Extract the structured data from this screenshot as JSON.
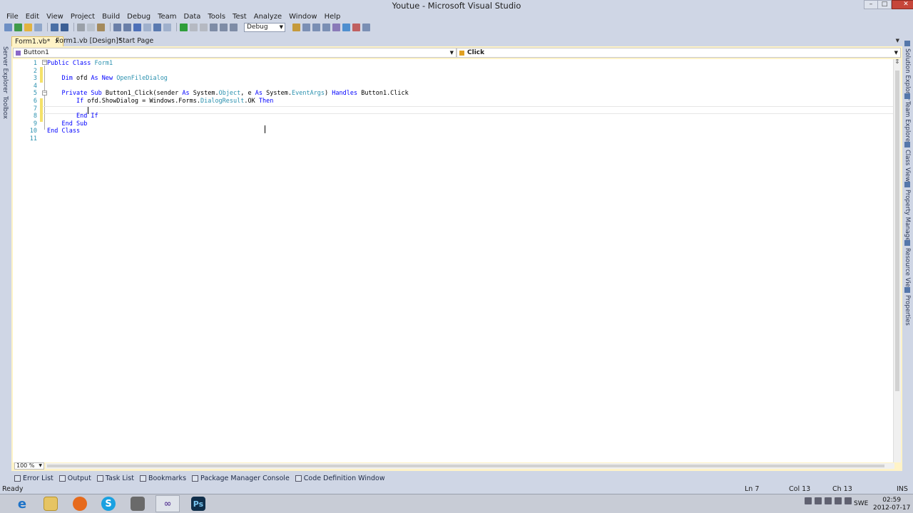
{
  "window": {
    "title": "Youtue - Microsoft Visual Studio",
    "min_glyph": "–",
    "max_glyph": "□",
    "close_glyph": "✕"
  },
  "menu": [
    "File",
    "Edit",
    "View",
    "Project",
    "Build",
    "Debug",
    "Team",
    "Data",
    "Tools",
    "Test",
    "Analyze",
    "Window",
    "Help"
  ],
  "toolbar": {
    "configuration": "Debug"
  },
  "doc_tabs": [
    {
      "label": "Form1.vb*",
      "active": true
    },
    {
      "label": "Form1.vb [Design]*",
      "active": false
    },
    {
      "label": "Start Page",
      "active": false
    }
  ],
  "nav": {
    "class_combo": "Button1",
    "member_combo": "Click"
  },
  "left_panels": [
    "Server Explorer",
    "Toolbox"
  ],
  "right_panels": [
    "Solution Explorer",
    "Team Explorer",
    "Class View",
    "Property Manager",
    "Resource View",
    "Properties"
  ],
  "editor": {
    "line_numbers": [
      "1",
      "2",
      "3",
      "4",
      "5",
      "6",
      "7",
      "8",
      "9",
      "10",
      "11"
    ],
    "lines": [
      [
        {
          "t": "Public Class ",
          "c": "kw"
        },
        {
          "t": "Form1",
          "c": "ty"
        }
      ],
      [],
      [
        {
          "t": "    "
        },
        {
          "t": "Dim",
          "c": "kw"
        },
        {
          "t": " ofd "
        },
        {
          "t": "As New",
          "c": "kw"
        },
        {
          "t": " "
        },
        {
          "t": "OpenFileDialog",
          "c": "ty"
        }
      ],
      [],
      [
        {
          "t": "    "
        },
        {
          "t": "Private Sub",
          "c": "kw"
        },
        {
          "t": " Button1_Click(sender "
        },
        {
          "t": "As",
          "c": "kw"
        },
        {
          "t": " System."
        },
        {
          "t": "Object",
          "c": "ty"
        },
        {
          "t": ", e "
        },
        {
          "t": "As",
          "c": "kw"
        },
        {
          "t": " System."
        },
        {
          "t": "EventArgs",
          "c": "ty"
        },
        {
          "t": ") "
        },
        {
          "t": "Handles",
          "c": "kw"
        },
        {
          "t": " Button1.Click"
        }
      ],
      [
        {
          "t": "        "
        },
        {
          "t": "If",
          "c": "kw"
        },
        {
          "t": " ofd.ShowDialog = Windows.Forms."
        },
        {
          "t": "DialogResult",
          "c": "ty"
        },
        {
          "t": ".OK "
        },
        {
          "t": "Then",
          "c": "kw"
        }
      ],
      [],
      [
        {
          "t": "        "
        },
        {
          "t": "End If",
          "c": "kw"
        }
      ],
      [
        {
          "t": "    "
        },
        {
          "t": "End Sub",
          "c": "kw"
        }
      ],
      [
        {
          "t": "End Class",
          "c": "kw"
        }
      ],
      []
    ],
    "zoom": "100 %"
  },
  "tool_tabs": [
    "Error List",
    "Output",
    "Task List",
    "Bookmarks",
    "Package Manager Console",
    "Code Definition Window"
  ],
  "status": {
    "message": "Ready",
    "line": "Ln 7",
    "col": "Col 13",
    "ch": "Ch 13",
    "mode": "INS"
  },
  "taskbar": {
    "language": "SWE",
    "time": "02:59",
    "date": "2012-07-17"
  },
  "colors": {
    "keyword": "#0000ff",
    "type": "#2b91af",
    "accent_tab": "#fff3c7",
    "frame": "#cfd6e5"
  }
}
